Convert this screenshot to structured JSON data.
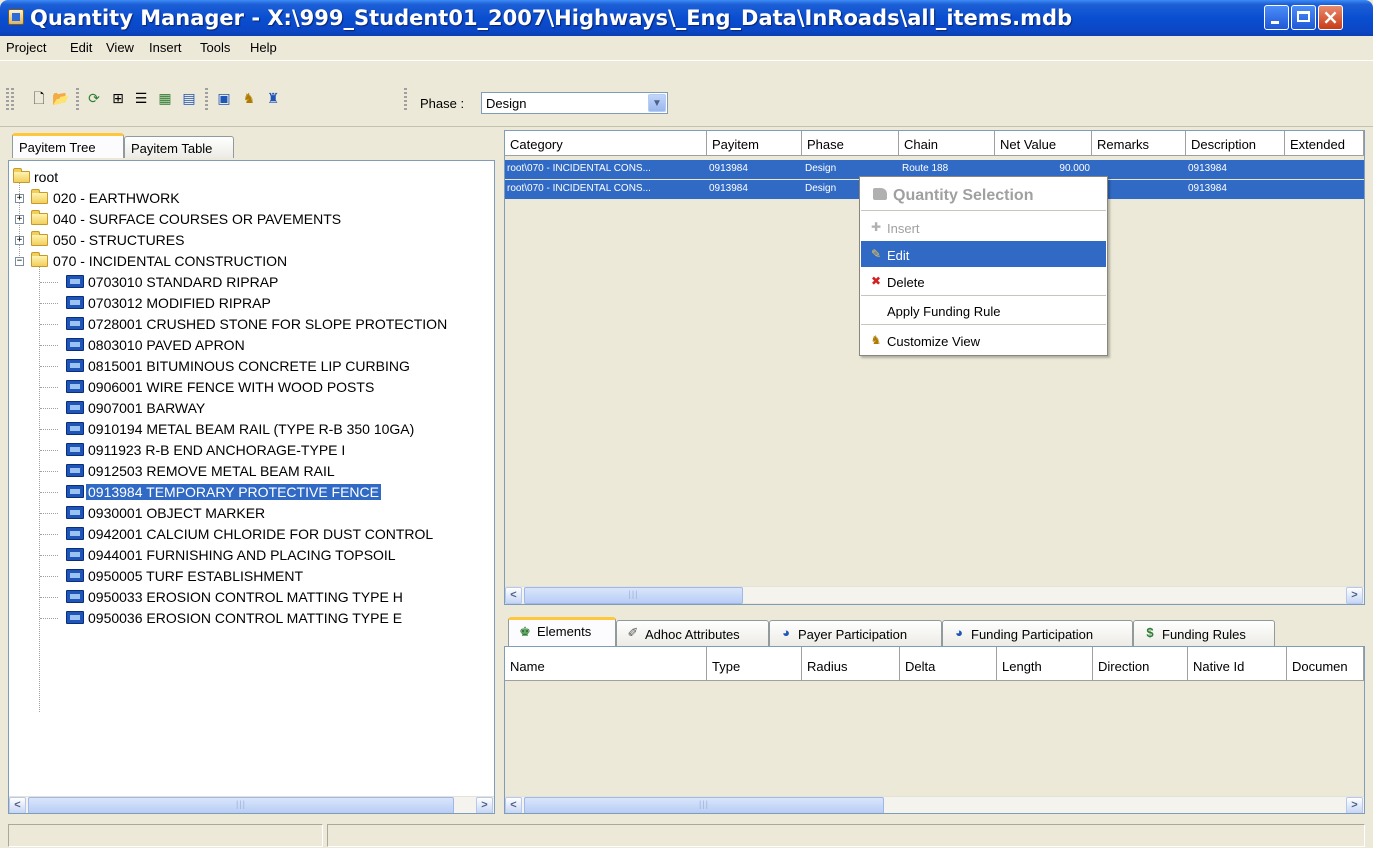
{
  "window": {
    "title": "Quantity Manager - X:\\999_Student01_2007\\Highways\\_Eng_Data\\InRoads\\all_items.mdb"
  },
  "menu": [
    "Project",
    "Edit",
    "View",
    "Insert",
    "Tools",
    "Help"
  ],
  "toolbar": {
    "icons": [
      "new-icon",
      "open-icon",
      "refresh-icon",
      "expand-all-icon",
      "collapse-all-icon",
      "add-category-icon",
      "add-payitem-icon",
      "report-icon",
      "funding-icon",
      "payer-icon"
    ],
    "phase_label": "Phase :",
    "phase_value": "Design"
  },
  "left_tabs": [
    "Payitem Tree",
    "Payitem Table"
  ],
  "tree": {
    "root": "root",
    "nodes": [
      "020 - EARTHWORK",
      "040 - SURFACE COURSES OR PAVEMENTS",
      "050 - STRUCTURES",
      "070 - INCIDENTAL CONSTRUCTION"
    ],
    "items": [
      "0703010 STANDARD RIPRAP",
      "0703012 MODIFIED RIPRAP",
      "0728001 CRUSHED STONE FOR SLOPE PROTECTION",
      "0803010 PAVED APRON",
      "0815001 BITUMINOUS CONCRETE LIP CURBING",
      "0906001 WIRE FENCE WITH WOOD POSTS",
      "0907001 BARWAY",
      "0910194 METAL BEAM RAIL (TYPE R-B 350 10GA)",
      "0911923 R-B END ANCHORAGE-TYPE I",
      "0912503 REMOVE METAL BEAM RAIL",
      "0913984 TEMPORARY PROTECTIVE FENCE",
      "0930001 OBJECT MARKER",
      "0942001 CALCIUM CHLORIDE FOR DUST CONTROL",
      "0944001 FURNISHING AND PLACING TOPSOIL",
      "0950005 TURF ESTABLISHMENT",
      "0950033 EROSION CONTROL MATTING TYPE H",
      "0950036 EROSION CONTROL MATTING TYPE E"
    ],
    "selected_item": "0913984 TEMPORARY PROTECTIVE FENCE"
  },
  "quantity_grid": {
    "headers": [
      "Category",
      "Payitem",
      "Phase",
      "Chain",
      "Net Value",
      "Remarks",
      "Description",
      "Extended"
    ],
    "rows": [
      [
        "root\\070 - INCIDENTAL CONS...",
        "0913984",
        "Design",
        "Route 188",
        "90.000",
        "",
        "0913984",
        ""
      ],
      [
        "root\\070 - INCIDENTAL CONS...",
        "0913984",
        "Design",
        "",
        "",
        "",
        "0913984",
        ""
      ]
    ]
  },
  "context_menu": {
    "header": "Quantity Selection",
    "items": [
      "Insert",
      "Edit",
      "Delete",
      "Apply Funding Rule",
      "Customize View"
    ],
    "highlighted": "Edit"
  },
  "bottom_tabs": [
    "Elements",
    "Adhoc Attributes",
    "Payer Participation",
    "Funding Participation",
    "Funding Rules"
  ],
  "elements_grid": {
    "headers": [
      "Name",
      "Type",
      "Radius",
      "Delta",
      "Length",
      "Direction",
      "Native Id",
      "Documen"
    ]
  },
  "colors": {
    "titlebar": "#0A4ED1",
    "selection": "#316AC5",
    "window_bg": "#ECE9D8",
    "tab_accent": "#FFC83C"
  }
}
